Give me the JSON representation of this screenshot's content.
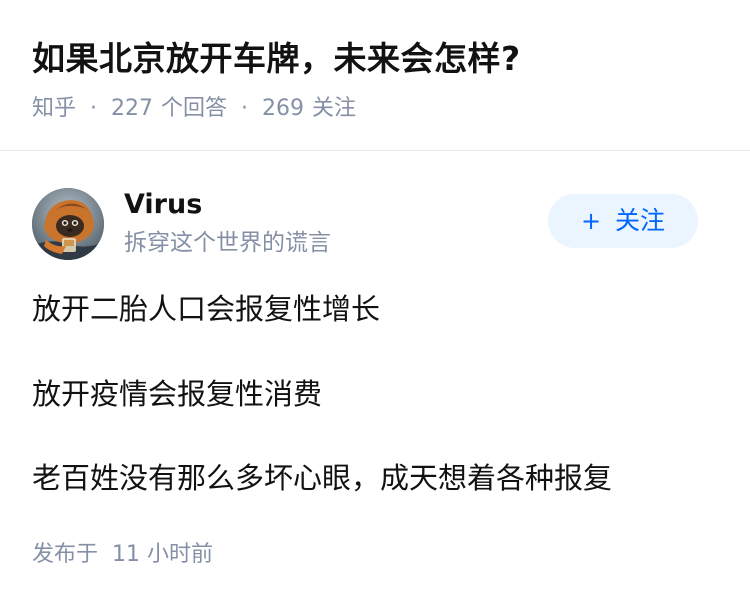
{
  "question": {
    "title": "如果北京放开车牌，未来会怎样?",
    "source": "知乎",
    "separator": "·",
    "answer_count": "227",
    "answer_label": "个回答",
    "follower_count": "269",
    "follower_label": "关注"
  },
  "answer": {
    "author": {
      "name": "Virus",
      "bio": "拆穿这个世界的谎言",
      "avatar_icon": "avatar-photo-icon"
    },
    "follow_button": {
      "icon": "plus",
      "plus_glyph": "+",
      "label": "关注"
    },
    "paragraphs": [
      "放开二胎人口会报复性增长",
      "放开疫情会报复性消费",
      "老百姓没有那么多坏心眼，成天想着各种报复"
    ],
    "publish_label": "发布于",
    "publish_time": "11 小时前"
  },
  "colors": {
    "primary_text": "#121212",
    "secondary_text": "#8590a6",
    "accent_blue": "#0066ff",
    "follow_bg": "#ebf5ff",
    "divider": "#ebebeb"
  }
}
